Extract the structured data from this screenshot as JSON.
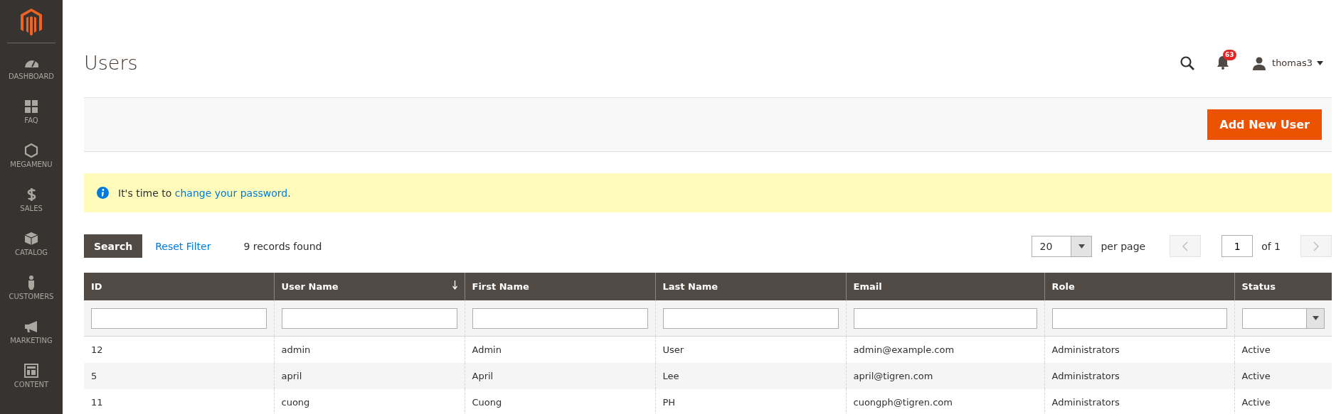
{
  "sidebar": {
    "items": [
      {
        "label": "DASHBOARD",
        "selected": false
      },
      {
        "label": "FAQ",
        "selected": false
      },
      {
        "label": "MEGAMENU",
        "selected": false
      },
      {
        "label": "SALES",
        "selected": false
      },
      {
        "label": "CATALOG",
        "selected": false
      },
      {
        "label": "CUSTOMERS",
        "selected": false
      },
      {
        "label": "MARKETING",
        "selected": false
      },
      {
        "label": "CONTENT",
        "selected": false
      }
    ]
  },
  "page_title": "Users",
  "header": {
    "notifications": "63",
    "user": "thomas3"
  },
  "actions": {
    "add_button": "Add New User"
  },
  "message": {
    "before": "It's time to ",
    "link": "change your password",
    "after": "."
  },
  "toolbar": {
    "search_button": "Search",
    "reset_link": "Reset Filter",
    "records": "9 records found",
    "per_page_value": "20",
    "per_page_label": "per page",
    "page_value": "1",
    "page_total": "of 1",
    "prev_disabled": true,
    "next_disabled": true
  },
  "table": {
    "columns": [
      {
        "label": "ID",
        "sorted": false,
        "kind": "text"
      },
      {
        "label": "User Name",
        "sorted": true,
        "kind": "text"
      },
      {
        "label": "First Name",
        "sorted": false,
        "kind": "text"
      },
      {
        "label": "Last Name",
        "sorted": false,
        "kind": "text"
      },
      {
        "label": "Email",
        "sorted": false,
        "kind": "text"
      },
      {
        "label": "Role",
        "sorted": false,
        "kind": "text"
      },
      {
        "label": "Status",
        "sorted": false,
        "kind": "select"
      }
    ],
    "rows": [
      [
        "12",
        "admin",
        "Admin",
        "User",
        "admin@example.com",
        "Administrators",
        "Active"
      ],
      [
        "5",
        "april",
        "April",
        "Lee",
        "april@tigren.com",
        "Administrators",
        "Active"
      ],
      [
        "11",
        "cuong",
        "Cuong",
        "PH",
        "cuongph@tigren.com",
        "Administrators",
        "Active"
      ]
    ]
  }
}
